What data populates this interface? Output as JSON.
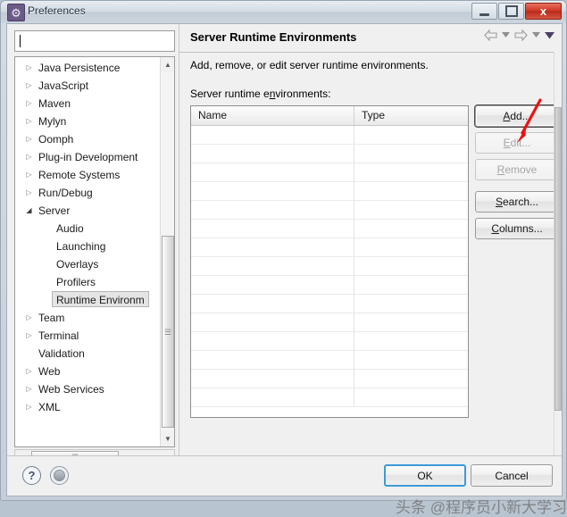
{
  "window": {
    "title": "Preferences",
    "icon": "gear-icon",
    "controls": {
      "minimize": "minimize-icon",
      "maximize": "maximize-icon",
      "close": "x"
    }
  },
  "sidebar": {
    "filter": {
      "value": "",
      "placeholder": ""
    },
    "items": [
      {
        "label": "Java Persistence",
        "arrow": "▷",
        "level": 0,
        "expanded": false,
        "selected": false
      },
      {
        "label": "JavaScript",
        "arrow": "▷",
        "level": 0,
        "expanded": false,
        "selected": false
      },
      {
        "label": "Maven",
        "arrow": "▷",
        "level": 0,
        "expanded": false,
        "selected": false
      },
      {
        "label": "Mylyn",
        "arrow": "▷",
        "level": 0,
        "expanded": false,
        "selected": false
      },
      {
        "label": "Oomph",
        "arrow": "▷",
        "level": 0,
        "expanded": false,
        "selected": false
      },
      {
        "label": "Plug-in Development",
        "arrow": "▷",
        "level": 0,
        "expanded": false,
        "selected": false
      },
      {
        "label": "Remote Systems",
        "arrow": "▷",
        "level": 0,
        "expanded": false,
        "selected": false
      },
      {
        "label": "Run/Debug",
        "arrow": "▷",
        "level": 0,
        "expanded": false,
        "selected": false
      },
      {
        "label": "Server",
        "arrow": "◢",
        "level": 0,
        "expanded": true,
        "selected": false
      },
      {
        "label": "Audio",
        "arrow": "",
        "level": 1,
        "expanded": false,
        "selected": false
      },
      {
        "label": "Launching",
        "arrow": "",
        "level": 1,
        "expanded": false,
        "selected": false
      },
      {
        "label": "Overlays",
        "arrow": "",
        "level": 1,
        "expanded": false,
        "selected": false
      },
      {
        "label": "Profilers",
        "arrow": "",
        "level": 1,
        "expanded": false,
        "selected": false
      },
      {
        "label": "Runtime Environm",
        "arrow": "",
        "level": 1,
        "expanded": false,
        "selected": true
      },
      {
        "label": "Team",
        "arrow": "▷",
        "level": 0,
        "expanded": false,
        "selected": false
      },
      {
        "label": "Terminal",
        "arrow": "▷",
        "level": 0,
        "expanded": false,
        "selected": false
      },
      {
        "label": "Validation",
        "arrow": "",
        "level": 0,
        "expanded": false,
        "selected": false
      },
      {
        "label": "Web",
        "arrow": "▷",
        "level": 0,
        "expanded": false,
        "selected": false
      },
      {
        "label": "Web Services",
        "arrow": "▷",
        "level": 0,
        "expanded": false,
        "selected": false
      },
      {
        "label": "XML",
        "arrow": "▷",
        "level": 0,
        "expanded": false,
        "selected": false
      }
    ],
    "scroll_up": "▲",
    "scroll_down": "▼",
    "scroll_left": "◀",
    "scroll_right": "▶",
    "grip": "≡"
  },
  "page": {
    "title": "Server Runtime Environments",
    "description": "Add, remove, or edit server runtime environments.",
    "list_label_pre": "Server runtime e",
    "list_label_mnemonic": "n",
    "list_label_post": "vironments:",
    "nav": {
      "back": "⇦",
      "back_menu": "▾",
      "forward": "⇨",
      "forward_menu": "▾",
      "view_menu": "▼"
    }
  },
  "table": {
    "columns": [
      "Name",
      "Type"
    ],
    "rows": [],
    "empty_row_count": 15
  },
  "buttons": {
    "side": [
      {
        "label": "Add...",
        "mnemonic": "A",
        "enabled": true,
        "focused": true,
        "gap": false
      },
      {
        "label": "Edit...",
        "mnemonic": "E",
        "enabled": false,
        "focused": false,
        "gap": false
      },
      {
        "label": "Remove",
        "mnemonic": "R",
        "enabled": false,
        "focused": false,
        "gap": false
      },
      {
        "label": "Search...",
        "mnemonic": "S",
        "enabled": true,
        "focused": false,
        "gap": true
      },
      {
        "label": "Columns...",
        "mnemonic": "C",
        "enabled": true,
        "focused": false,
        "gap": false
      }
    ],
    "ok": "OK",
    "cancel": "Cancel"
  },
  "bottom": {
    "help_icon": "?",
    "apply_icon": "apply-icon"
  },
  "annotations": {
    "arrow_color": "#ee1111",
    "arrow_target": "Add...",
    "watermark": "头条 @程序员小新大学习"
  },
  "colors": {
    "accent": "#3c9ad6",
    "close_button": "#cf3a28",
    "annotation_red": "#ee1111",
    "selection": "#e4e4e4"
  }
}
